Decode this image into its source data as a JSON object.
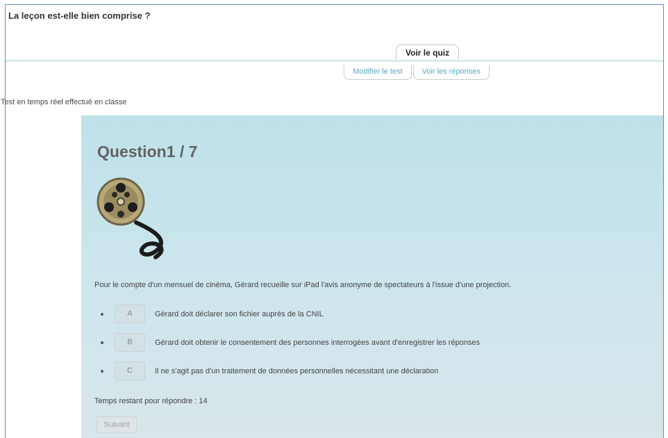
{
  "section": {
    "title": "La leçon est-elle bien comprise ?"
  },
  "tabs": {
    "primary": "Voir le quiz",
    "secondary": [
      "Modifier le test",
      "Voir les réponses"
    ]
  },
  "intro": "Test en temps réel effectué en classe",
  "quiz": {
    "question_label": "Question1 / 7",
    "media_icon": "film-reel-icon",
    "question_text": "Pour le compte d'un mensuel de cinéma, Gérard recueille sur iPad l'avis anonyme de spectateurs à l'issue d'une projection.",
    "answers": [
      {
        "letter": "A",
        "text": "Gérard doit déclarer son fichier auprès de la CNIL"
      },
      {
        "letter": "B",
        "text": "Gérard doit obtenir le consentement des personnes interrogées avant d'enregistrer les réponses"
      },
      {
        "letter": "C",
        "text": "Il ne s'agit pas d'un traitement de données personnelles nécessitant une déclaration"
      }
    ],
    "timer_text": "Temps restant pour répondre : 14",
    "next_label": "Suivant"
  },
  "colors": {
    "panel": "#c6e3eb",
    "accent": "#5aa8c4",
    "frame": "#5b8bc5"
  }
}
